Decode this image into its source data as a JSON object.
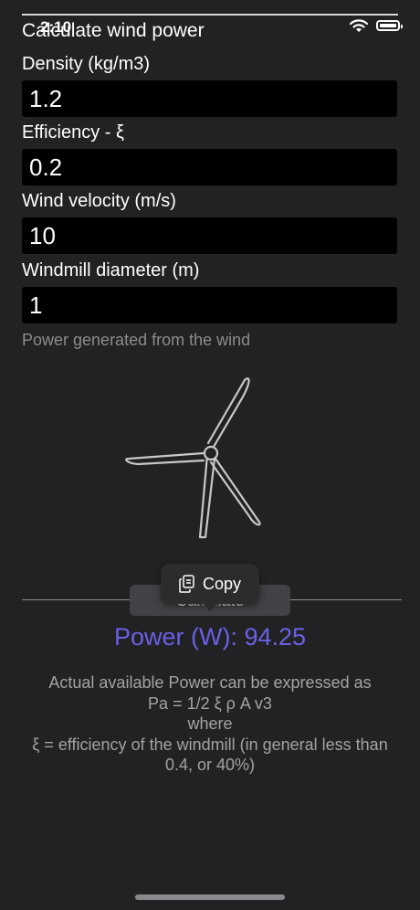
{
  "status_bar": {
    "time": "2:10"
  },
  "title": "Calculate wind power",
  "fields": [
    {
      "label": "Density (kg/m3)",
      "value": "1.2"
    },
    {
      "label": "Efficiency - ξ",
      "value": "0.2"
    },
    {
      "label": "Wind velocity (m/s)",
      "value": "10"
    },
    {
      "label": "Windmill diameter (m)",
      "value": "1"
    }
  ],
  "hint": "Power generated from the wind",
  "calculate_button": "Calculate",
  "context_menu": {
    "copy_label": "Copy"
  },
  "result": "Power (W): 94.25",
  "description": {
    "line1": "Actual available Power can be expressed as",
    "line2": "Pa = 1/2 ξ ρ A v3",
    "line3": "where",
    "line4": "ξ = efficiency of the windmill (in general less than 0.4, or 40%)"
  },
  "colors": {
    "accent": "#6a60e6",
    "background": "#222224",
    "field": "#000000"
  }
}
